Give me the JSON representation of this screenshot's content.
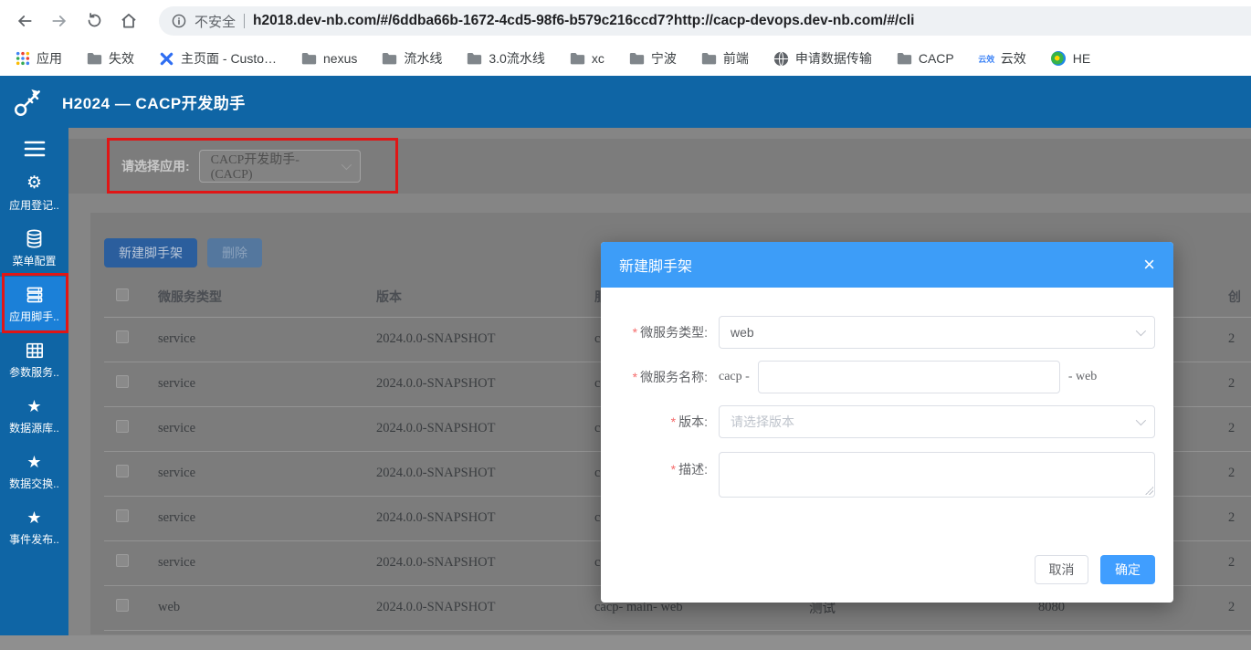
{
  "colors": {
    "header_blue": "#0f65a5",
    "sidebar_active_blue": "#1b80d8",
    "modal_header_blue": "#3d9df8",
    "primary_blue": "#409eff",
    "annotation_red": "#e01616",
    "required_red": "#f56c6c"
  },
  "browser": {
    "security_label": "不安全",
    "url": "h2018.dev-nb.com/#/6ddba66b-1672-4cd5-98f6-b579c216ccd7?http://cacp-devops.dev-nb.com/#/cli",
    "bookmarks": [
      {
        "key": "apps",
        "icon": "apps-grid",
        "label": "应用"
      },
      {
        "key": "shixiao",
        "icon": "folder",
        "label": "失效"
      },
      {
        "key": "homepage",
        "icon": "x-logo",
        "label": "主页面 - Custo…"
      },
      {
        "key": "nexus",
        "icon": "folder",
        "label": "nexus"
      },
      {
        "key": "pipeline",
        "icon": "folder",
        "label": "流水线"
      },
      {
        "key": "pipeline30",
        "icon": "folder",
        "label": "3.0流水线"
      },
      {
        "key": "xc",
        "icon": "folder",
        "label": "xc"
      },
      {
        "key": "ningbo",
        "icon": "folder",
        "label": "宁波"
      },
      {
        "key": "frontend",
        "icon": "folder",
        "label": "前端"
      },
      {
        "key": "data-transfer",
        "icon": "globe",
        "label": "申请数据传输"
      },
      {
        "key": "cacp",
        "icon": "folder",
        "label": "CACP"
      },
      {
        "key": "yunxiao",
        "icon": "yunxiao",
        "label": "云效"
      },
      {
        "key": "he",
        "icon": "sphere",
        "label": "HE"
      }
    ]
  },
  "app_header": {
    "title": "H2024 — CACP开发助手"
  },
  "sidebar": {
    "items": [
      {
        "key": "app-registry",
        "icon": "gear",
        "label": "应用登记..",
        "active": false
      },
      {
        "key": "menu-config",
        "icon": "database",
        "label": "菜单配置",
        "active": false
      },
      {
        "key": "app-scaffold",
        "icon": "server",
        "label": "应用脚手..",
        "active": true
      },
      {
        "key": "param-service",
        "icon": "grid",
        "label": "参数服务..",
        "active": false
      },
      {
        "key": "data-source",
        "icon": "star",
        "label": "数据源库..",
        "active": false
      },
      {
        "key": "data-exchange",
        "icon": "star",
        "label": "数据交换..",
        "active": false
      },
      {
        "key": "event-publish",
        "icon": "star",
        "label": "事件发布..",
        "active": false
      }
    ]
  },
  "main": {
    "app_select": {
      "label": "请选择应用:",
      "value": "CACP开发助手-(CACP)"
    },
    "toolbar": {
      "create_label": "新建脚手架",
      "delete_label": "删除"
    },
    "table": {
      "headers": {
        "type": "微服务类型",
        "version": "版本",
        "name": "服",
        "created": "创"
      },
      "rows": [
        {
          "type": "service",
          "version": "2024.0.0-SNAPSHOT",
          "name": "c",
          "desc": "",
          "port": "",
          "created": "2"
        },
        {
          "type": "service",
          "version": "2024.0.0-SNAPSHOT",
          "name": "c",
          "desc": "",
          "port": "",
          "created": "2"
        },
        {
          "type": "service",
          "version": "2024.0.0-SNAPSHOT",
          "name": "c",
          "desc": "",
          "port": "",
          "created": "2"
        },
        {
          "type": "service",
          "version": "2024.0.0-SNAPSHOT",
          "name": "c",
          "desc": "",
          "port": "",
          "created": "2"
        },
        {
          "type": "service",
          "version": "2024.0.0-SNAPSHOT",
          "name": "c",
          "desc": "",
          "port": "",
          "created": "2"
        },
        {
          "type": "service",
          "version": "2024.0.0-SNAPSHOT",
          "name": "c",
          "desc": "",
          "port": "",
          "created": "2"
        },
        {
          "type": "web",
          "version": "2024.0.0-SNAPSHOT",
          "name": "cacp- main- web",
          "desc": "测试",
          "port": "8080",
          "created": "2"
        }
      ]
    }
  },
  "modal": {
    "title": "新建脚手架",
    "required_marker": "*",
    "fields": {
      "type": {
        "label": "微服务类型:",
        "value": "web"
      },
      "name": {
        "label": "微服务名称:",
        "prefix": "cacp -",
        "value": "",
        "suffix": "- web"
      },
      "version": {
        "label": "版本:",
        "placeholder": "请选择版本"
      },
      "desc": {
        "label": "描述:",
        "value": ""
      }
    },
    "footer": {
      "cancel_label": "取消",
      "confirm_label": "确定"
    }
  }
}
